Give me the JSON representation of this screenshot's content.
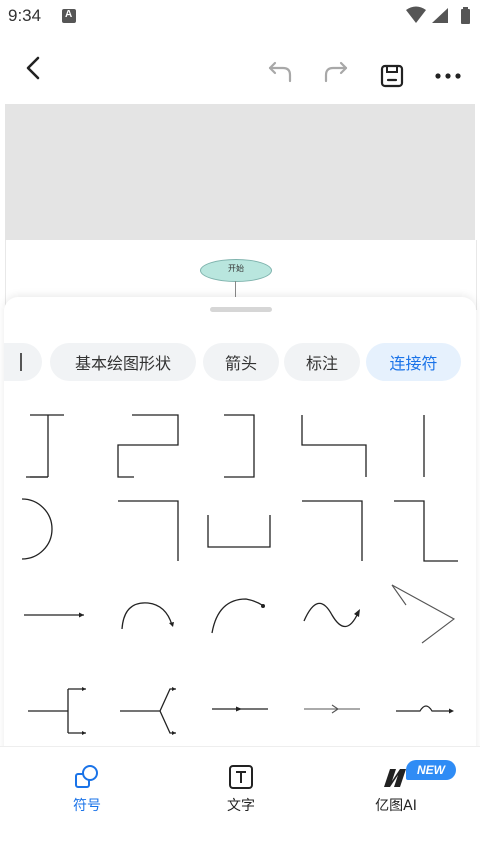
{
  "status_bar": {
    "time": "9:34",
    "notification_letter": "A"
  },
  "canvas": {
    "start_node_label": "开始"
  },
  "categories": [
    {
      "label": "",
      "active": false
    },
    {
      "label": "基本绘图形状",
      "active": false
    },
    {
      "label": "箭头",
      "active": false
    },
    {
      "label": "标注",
      "active": false
    },
    {
      "label": "连接符",
      "active": true
    }
  ],
  "connectors": [
    "elbow-up-right",
    "zigzag-connector",
    "bracket-right",
    "corner-down-right",
    "vertical-line",
    "arc-left",
    "elbow-down",
    "u-shape",
    "corner-right-down",
    "step-down-right",
    "straight-arrow",
    "arc-arrow",
    "arc-arrow-dot",
    "wave-arrow",
    "angle-connector",
    "fork-connector",
    "fork-angled-connector",
    "dot-arrow-line",
    "open-arrow-line",
    "bump-arrow-line"
  ],
  "bottom_nav": {
    "items": [
      {
        "label": "符号",
        "active": true
      },
      {
        "label": "文字",
        "active": false
      },
      {
        "label": "亿图AI",
        "active": false
      }
    ],
    "new_badge": "NEW"
  },
  "colors": {
    "accent": "#1a73e8",
    "ai_badge": "#2f8cf5"
  }
}
